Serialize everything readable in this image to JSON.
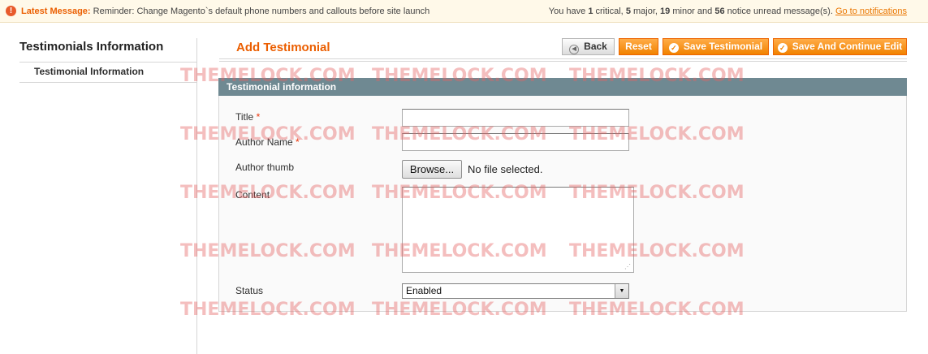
{
  "notification": {
    "icon": "alert-icon",
    "label": "Latest Message:",
    "message": "Reminder: Change Magento`s default phone numbers and callouts before site launch",
    "summary_prefix": "You have",
    "critical_count": "1",
    "critical_text": "critical,",
    "major_count": "5",
    "major_text": "major,",
    "minor_count": "19",
    "minor_text": "minor and",
    "notice_count": "56",
    "notice_text": "notice unread message(s).",
    "link": "Go to notifications"
  },
  "sidebar": {
    "title": "Testimonials Information",
    "tabs": [
      {
        "label": "Testimonial Information"
      }
    ]
  },
  "header": {
    "title": "Add Testimonial",
    "buttons": {
      "back": "Back",
      "reset": "Reset",
      "save": "Save Testimonial",
      "save_continue": "Save And Continue Edit"
    }
  },
  "form": {
    "section_title": "Testimonial information",
    "fields": {
      "title": {
        "label": "Title",
        "required": "*",
        "value": ""
      },
      "author_name": {
        "label": "Author Name",
        "required": "*",
        "value": ""
      },
      "author_thumb": {
        "label": "Author thumb",
        "button": "Browse...",
        "status": "No file selected."
      },
      "content": {
        "label": "Content",
        "value": ""
      },
      "status": {
        "label": "Status",
        "selected": "Enabled"
      }
    }
  },
  "watermark": {
    "text": "THEMELOCK.COM"
  },
  "colors": {
    "accent": "#eb5e00",
    "button_orange": "#f18200",
    "section_header": "#6f8992",
    "notice_background": "#fff9e9",
    "watermark": "#e56464"
  }
}
